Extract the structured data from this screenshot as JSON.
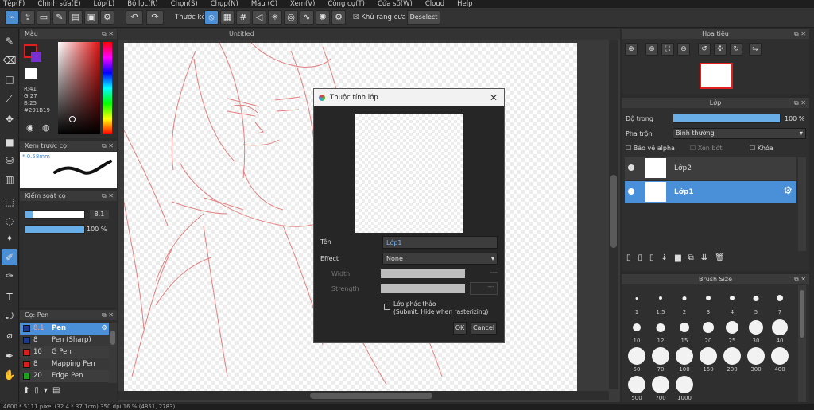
{
  "menu": [
    "Tệp(F)",
    "Chỉnh sửa(E)",
    "Lớp(L)",
    "Bộ lọc(R)",
    "Chọn(S)",
    "Chụp(N)",
    "Màu (C)",
    "Xem(V)",
    "Công cụ(T)",
    "Cửa sổ(W)",
    "Cloud",
    "Help"
  ],
  "toolbar": {
    "ruler_label": "Thước kẻ",
    "antialias_label": "Khử răng cưa",
    "deselect_label": "Deselect"
  },
  "color_panel": {
    "title": "Màu",
    "r": "R:41",
    "g": "G:27",
    "b": "B:25",
    "hex": "#291B19",
    "primary": "#e02020",
    "secondary": "#ffffff"
  },
  "preview_panel": {
    "title": "Xem trước cọ",
    "size": "* 0.58mm"
  },
  "control_panel": {
    "title": "Kiểm soát cọ",
    "size_value": "8.1",
    "opacity_value": "100 %",
    "size_fraction": 0.81,
    "opacity_fraction": 1.0
  },
  "brush_panel": {
    "title": "Cọ: Pen",
    "items": [
      {
        "size": "8.1",
        "name": "Pen",
        "color": "#1e3a8a",
        "selected": true
      },
      {
        "size": "8",
        "name": "Pen (Sharp)",
        "color": "#1e3a8a",
        "selected": false
      },
      {
        "size": "10",
        "name": "G Pen",
        "color": "#d62020",
        "selected": false
      },
      {
        "size": "8",
        "name": "Mapping Pen",
        "color": "#d62020",
        "selected": false
      },
      {
        "size": "20",
        "name": "Edge Pen",
        "color": "#20a020",
        "selected": false
      }
    ]
  },
  "document": {
    "title": "Untitled"
  },
  "dialog": {
    "title": "Thuộc tính lớp",
    "name_label": "Tên",
    "name_value": "Lớp1",
    "effect_label": "Effect",
    "effect_value": "None",
    "width_label": "Width",
    "strength_label": "Strength",
    "sketch_label": "Lớp phác thảo",
    "sketch_sub": "(Submit: Hide when rasterizing)",
    "ok_label": "OK",
    "cancel_label": "Cancel"
  },
  "navigator": {
    "title": "Hoa tiêu"
  },
  "layers_panel": {
    "title": "Lớp",
    "opacity_label": "Độ trong",
    "opacity_value": "100 %",
    "opacity_fraction": 1.0,
    "blend_label": "Pha trộn",
    "blend_value": "Bình thường",
    "protect_alpha": "Bảo vệ alpha",
    "clipping": "Xén bớt",
    "lock": "Khóa",
    "layers": [
      {
        "name": "Lớp2",
        "selected": false
      },
      {
        "name": "Lớp1",
        "selected": true
      }
    ]
  },
  "brush_size": {
    "title": "Brush Size",
    "sizes": [
      "1",
      "1.5",
      "2",
      "3",
      "4",
      "5",
      "7",
      "10",
      "12",
      "15",
      "20",
      "25",
      "30",
      "40",
      "50",
      "70",
      "100",
      "150",
      "200",
      "300",
      "400",
      "500",
      "700",
      "1000"
    ]
  },
  "status": {
    "text": "4600 * 5111 pixel  (32.4 * 37.1cm)  350 dpi  16 %  (4851, 2783)"
  }
}
